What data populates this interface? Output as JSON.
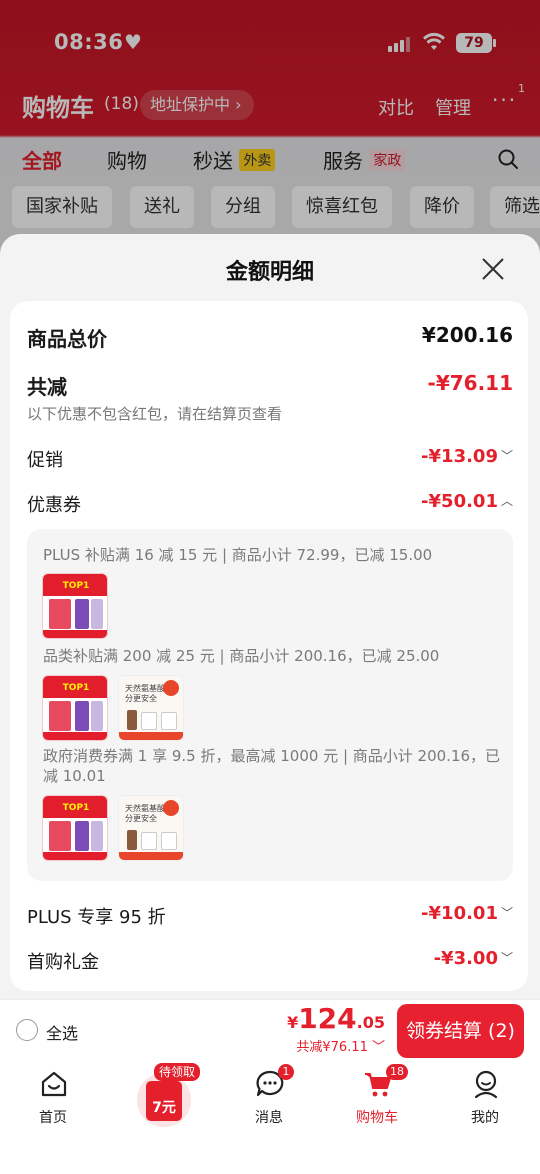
{
  "status_bar": {
    "time": "08:36",
    "heart": "♥",
    "battery": "79"
  },
  "cart_header": {
    "title": "购物车",
    "count": "(18)",
    "address_pill": "地址保护中 ›",
    "compare": "对比",
    "manage": "管理",
    "more": "···",
    "more_badge": "1"
  },
  "category_tabs": [
    {
      "label": "全部",
      "active": true
    },
    {
      "label": "购物"
    },
    {
      "label": "秒送",
      "tag": "外卖"
    },
    {
      "label": "服务",
      "tag": "家政"
    }
  ],
  "filters": [
    "国家补贴",
    "送礼",
    "分组",
    "惊喜红包",
    "降价",
    "筛选"
  ],
  "sheet": {
    "title": "金额明细",
    "total_label": "商品总价",
    "total_value": "¥200.16",
    "discount_label": "共减",
    "discount_value": "-¥76.11",
    "note": "以下优惠不包含红包，请在结算页查看",
    "promo_label": "促销",
    "promo_value": "-¥13.09",
    "coupon_label": "优惠券",
    "coupon_value": "-¥50.01",
    "coupons": [
      {
        "text": "PLUS 补贴满 16 减 15 元 | 商品小计 72.99，已减 15.00",
        "products": [
          "red"
        ]
      },
      {
        "text": "品类补贴满 200 减 25 元 | 商品小计 200.16，已减 25.00",
        "products": [
          "red",
          "white"
        ]
      },
      {
        "text": "政府消费券满 1 享 9.5 折，最高减 1000 元 | 商品小计 200.16，已减 10.01",
        "products": [
          "red",
          "white"
        ]
      }
    ],
    "product_thumb_text": {
      "red": "TOP1",
      "white": "天然氨基酸 成分更安全"
    },
    "plus_label": "PLUS 专享 95 折",
    "plus_value": "-¥10.01",
    "first_label": "首购礼金",
    "first_value": "-¥3.00"
  },
  "checkout": {
    "select_all": "全选",
    "currency": "¥",
    "price_int": "124",
    "price_dec": ".05",
    "saved": "共减¥76.11",
    "button": "领券结算 (2)"
  },
  "tabbar": {
    "home": "首页",
    "promo_badge": "待领取",
    "promo_amount": "7元",
    "messages": "消息",
    "messages_badge": "1",
    "cart": "购物车",
    "cart_badge": "18",
    "mine": "我的"
  },
  "colors": {
    "accent": "#e4202c",
    "header_red": "#c41626"
  }
}
